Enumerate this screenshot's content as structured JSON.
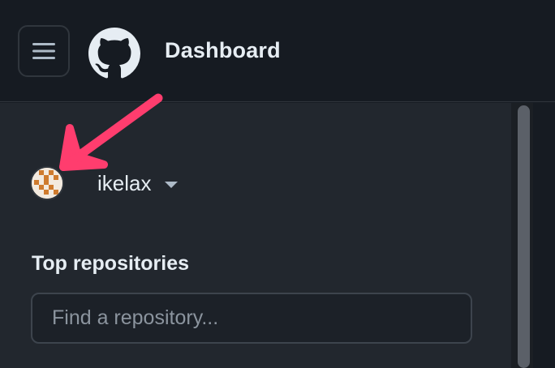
{
  "header": {
    "menu_icon": "hamburger-icon",
    "logo_icon": "github-octocat-icon",
    "title": "Dashboard"
  },
  "sidebar": {
    "user": {
      "avatar_icon": "user-avatar",
      "name": "ikelax",
      "switch_icon": "caret-down-icon"
    },
    "top_repositories": {
      "title": "Top repositories",
      "search_placeholder": "Find a repository..."
    }
  },
  "annotation": {
    "arrow_color": "#ff3d6e",
    "arrow_icon": "annotation-arrow"
  },
  "colors": {
    "header_bg": "#161b22",
    "sidebar_bg": "#22272e",
    "text": "#e6edf3",
    "placeholder": "#8b949e"
  }
}
